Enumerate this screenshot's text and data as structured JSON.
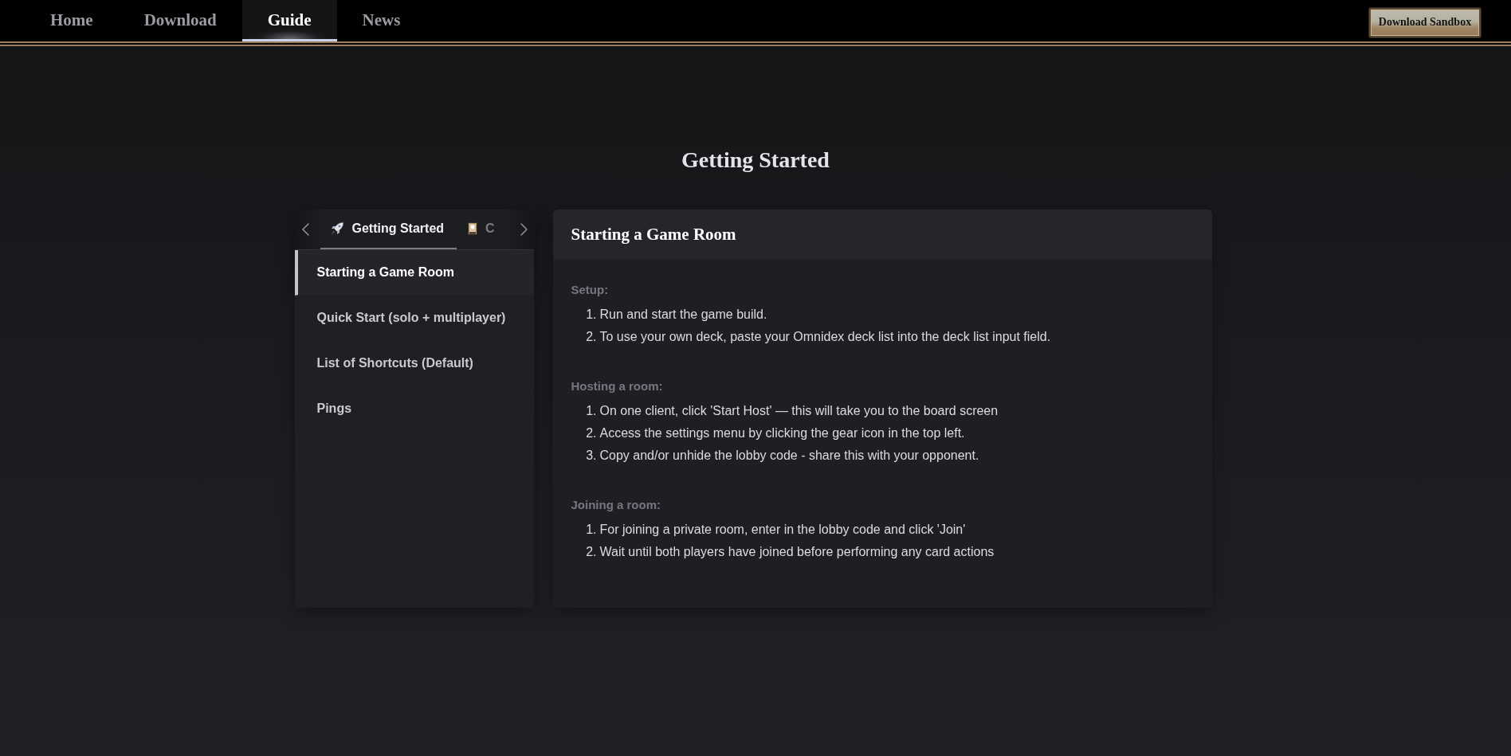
{
  "nav": {
    "tabs": [
      {
        "label": "Home",
        "selected": false
      },
      {
        "label": "Download",
        "selected": false
      },
      {
        "label": "Guide",
        "selected": true
      },
      {
        "label": "News",
        "selected": false
      }
    ],
    "download_button": "Download Sandbox"
  },
  "page_title": "Getting Started",
  "sidebar": {
    "tabs": [
      {
        "label": "Getting Started",
        "selected": true
      },
      {
        "label": "C",
        "selected": false
      }
    ],
    "items": [
      {
        "label": "Starting a Game Room",
        "selected": true
      },
      {
        "label": "Quick Start (solo + multiplayer)",
        "selected": false
      },
      {
        "label": "List of Shortcuts (Default)",
        "selected": false
      },
      {
        "label": "Pings",
        "selected": false
      }
    ]
  },
  "content": {
    "title": "Starting a Game Room",
    "sections": [
      {
        "heading": "Setup:",
        "steps": [
          {
            "number": "1.",
            "text": "Run and start the game build."
          },
          {
            "number": "2.",
            "text": "To use your own deck, paste your Omnidex deck list into the deck list input field."
          }
        ]
      },
      {
        "heading": "Hosting a room:",
        "steps": [
          {
            "number": "1.",
            "text": "On one client, click 'Start Host' — this will take you to the board screen"
          },
          {
            "number": "2.",
            "text": "Access the settings menu by clicking the gear icon in the top left."
          },
          {
            "number": "3.",
            "text": "Copy and/or unhide the lobby code - share this with your opponent."
          }
        ]
      },
      {
        "heading": "Joining a room:",
        "steps": [
          {
            "number": "1.",
            "text": "For joining a private room, enter in the lobby code and click 'Join'"
          },
          {
            "number": "2.",
            "text": "Wait until both players have joined before performing any card actions"
          }
        ]
      }
    ]
  }
}
